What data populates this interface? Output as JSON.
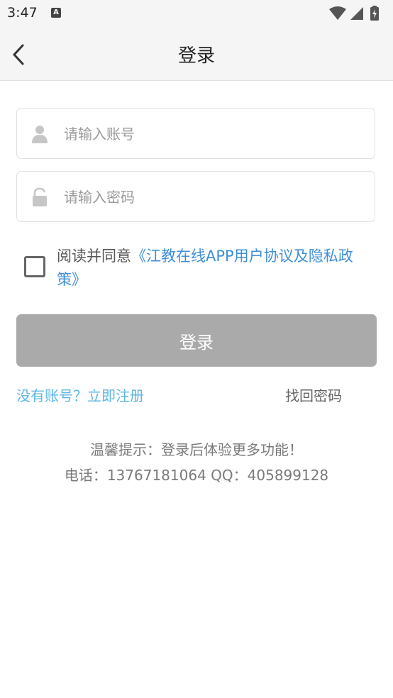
{
  "status_bar": {
    "time": "3:47",
    "notification_icon": "a-badge-icon",
    "icons": [
      "wifi-icon",
      "signal-icon",
      "battery-charging-icon"
    ]
  },
  "nav": {
    "back_icon": "chevron-left-icon",
    "title": "登录"
  },
  "form": {
    "account_placeholder": "请输入账号",
    "account_icon": "user-icon",
    "password_placeholder": "请输入密码",
    "password_icon": "lock-icon"
  },
  "agreement": {
    "checked": false,
    "prefix": "阅读并同意",
    "link": "《江教在线APP用户协议及隐私政策》"
  },
  "login_button": "登录",
  "links": {
    "register": "没有账号？立即注册",
    "forgot": "找回密码"
  },
  "tips": {
    "line1": "温馨提示：登录后体验更多功能！",
    "line2": "电话：13767181064 QQ：405899128"
  },
  "colors": {
    "link": "#3d8fd9",
    "register": "#5bb6e6",
    "button_disabled": "#aaaaaa",
    "header_bg": "#f5f5f5"
  }
}
